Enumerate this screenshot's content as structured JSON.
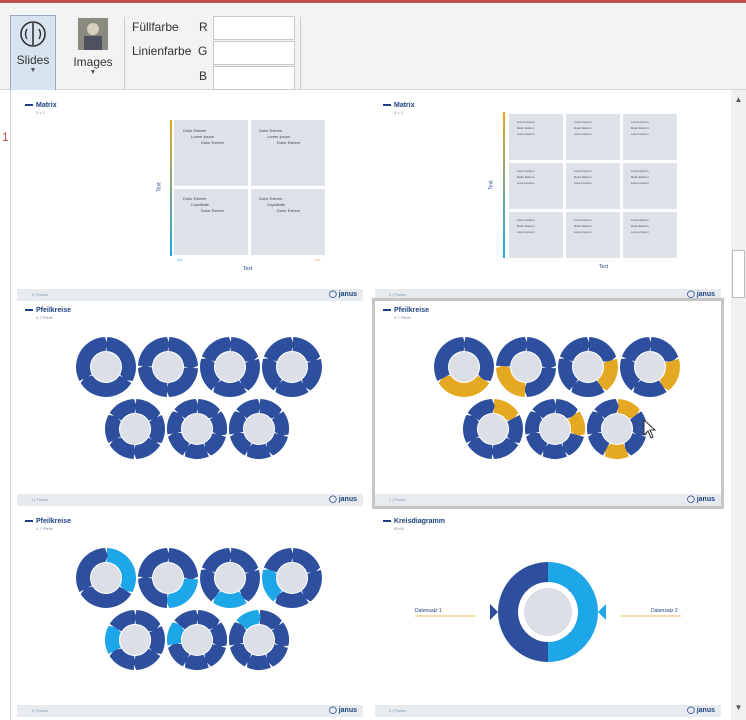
{
  "ribbon": {
    "slides_label": "Slides",
    "images_label": "Images",
    "fill_label": "Füllfarbe",
    "line_label": "Linienfarbe",
    "r_label": "R",
    "g_label": "G",
    "b_label": "B",
    "r_value": "",
    "g_value": "",
    "b_value": ""
  },
  "left_marker": "1",
  "slides": [
    {
      "title": "Matrix",
      "subtitle": "3 x 2",
      "footer_left": "1 | Footer",
      "footer_right": "◯ janus"
    },
    {
      "title": "Matrix",
      "subtitle": "3 x 3",
      "footer_left": "1 | Footer",
      "footer_right": "◯ janus"
    },
    {
      "title": "Pfeilkreise",
      "subtitle": "3-7 Pfeile",
      "footer_left": "1 | Footer",
      "footer_right": "◯ janus"
    },
    {
      "title": "Pfeilkreise",
      "subtitle": "3-7 Pfeile",
      "footer_left": "1 | Footer",
      "footer_right": "◯ janus"
    },
    {
      "title": "Pfeilkreise",
      "subtitle": "3-7 Pfeile",
      "footer_left": "1 | Footer",
      "footer_right": "◯ janus"
    },
    {
      "title": "Kreisdiagramm",
      "subtitle": "50/50",
      "footer_left": "1 | Footer",
      "footer_right": "◯ janus"
    }
  ],
  "matrix1": {
    "cell_text": [
      "Dolor Estrem",
      "Lorem Ipsum",
      "Dolor Estrem",
      "Dolor Estrem",
      "Lorem Ipsum",
      "Dolor Estrem",
      "Dolor Estrem",
      "Cupiditate",
      "Dolor Estrem",
      "Dolor Estrem",
      "Cupiditate",
      "Dolor Estrem"
    ],
    "y_axis": "Text",
    "x_axis": "Text",
    "low": "Text",
    "high": "Text"
  },
  "matrix2": {
    "cell_text": [
      "Lorem Ipsum",
      "Dolor Estrem",
      "Lorem Ipsum"
    ],
    "y_axis": "Text",
    "x_axis": "Text",
    "low": "Low",
    "high": "High"
  },
  "kreis": {
    "left_label": "Datensatz 1",
    "right_label": "Datensatz 2"
  },
  "colors": {
    "blue": "#2e4f9e",
    "orange": "#e5a823",
    "cyan": "#1ea7e8",
    "grey": "#dce0e6",
    "accent": "#c0504d"
  }
}
